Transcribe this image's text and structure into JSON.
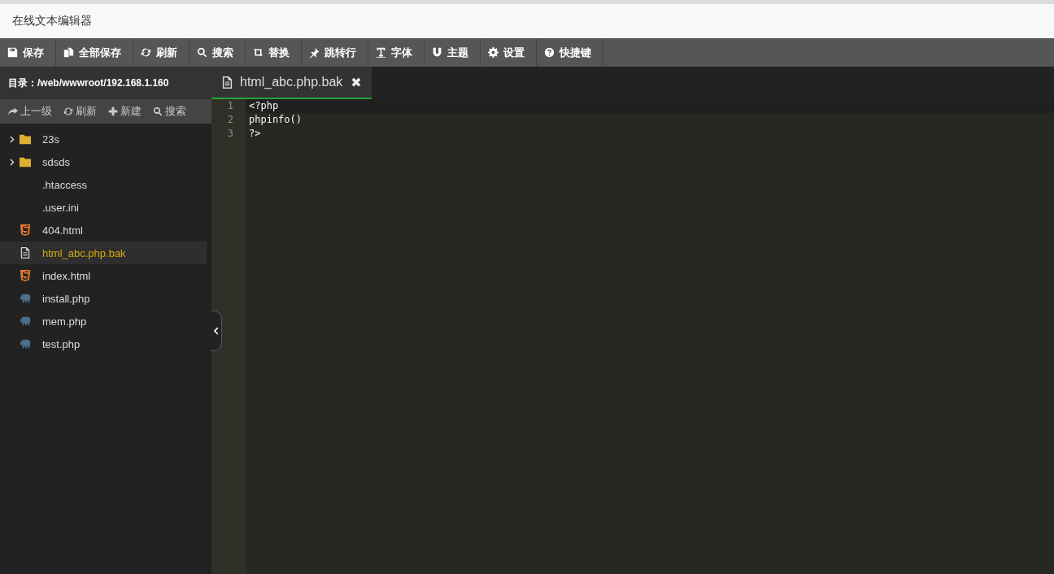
{
  "window": {
    "title": "在线文本编辑器"
  },
  "toolbar": [
    {
      "label": "保存"
    },
    {
      "label": "全部保存"
    },
    {
      "label": "刷新"
    },
    {
      "label": "搜索"
    },
    {
      "label": "替换"
    },
    {
      "label": "跳转行"
    },
    {
      "label": "字体"
    },
    {
      "label": "主题"
    },
    {
      "label": "设置"
    },
    {
      "label": "快捷键"
    }
  ],
  "sidebar": {
    "path": "目录：/web/wwwroot/192.168.1.160",
    "actions": [
      {
        "label": "上一级"
      },
      {
        "label": "刷新"
      },
      {
        "label": "新建"
      },
      {
        "label": "搜索"
      }
    ],
    "items": [
      {
        "kind": "folder",
        "name": "23s",
        "expanded": false,
        "selected": false
      },
      {
        "kind": "folder",
        "name": "sdsds",
        "expanded": false,
        "selected": false
      },
      {
        "kind": "plain",
        "name": ".htaccess",
        "selected": false
      },
      {
        "kind": "plain",
        "name": ".user.ini",
        "selected": false
      },
      {
        "kind": "html",
        "name": "404.html",
        "selected": false
      },
      {
        "kind": "text",
        "name": "html_abc.php.bak",
        "selected": true
      },
      {
        "kind": "html",
        "name": "index.html",
        "selected": false
      },
      {
        "kind": "php",
        "name": "install.php",
        "selected": false
      },
      {
        "kind": "php",
        "name": "mem.php",
        "selected": false
      },
      {
        "kind": "php",
        "name": "test.php",
        "selected": false
      }
    ]
  },
  "tabs": [
    {
      "label": "html_abc.php.bak",
      "selected": true,
      "close": "✖"
    }
  ],
  "editor": {
    "lines": [
      {
        "number": "1",
        "text": "<?php"
      },
      {
        "number": "2",
        "text": "phpinfo()"
      },
      {
        "number": "3",
        "text": "?>"
      }
    ]
  }
}
